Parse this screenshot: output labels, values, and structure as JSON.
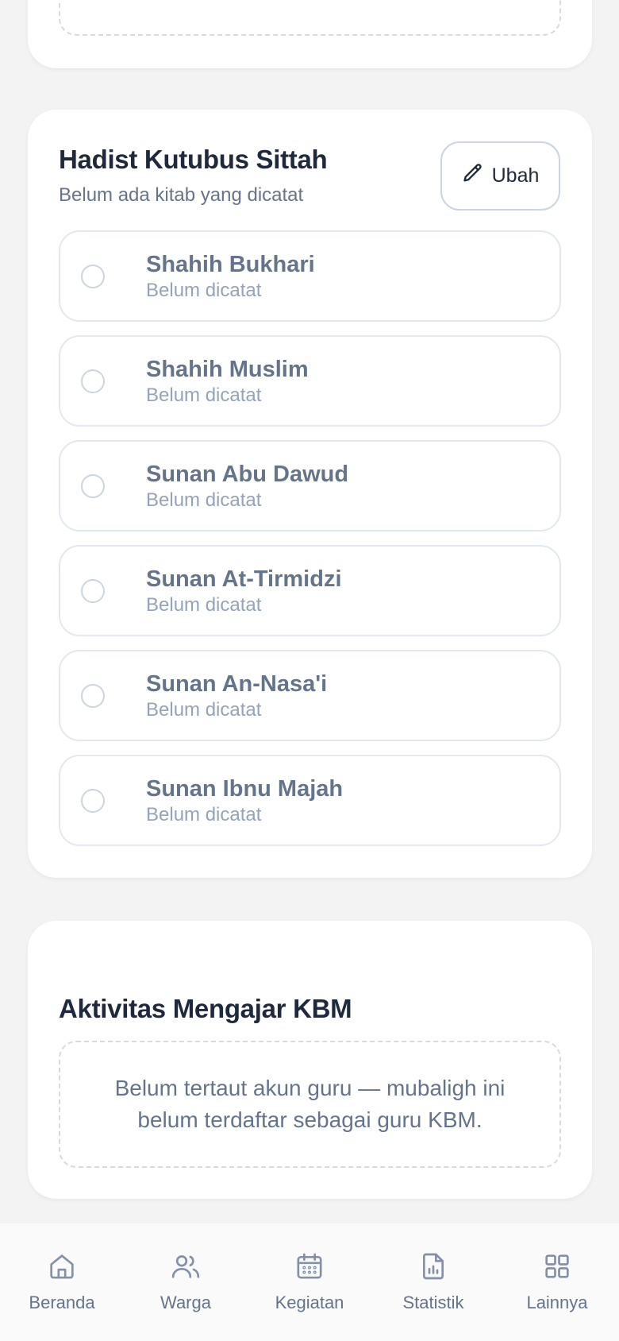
{
  "hadist": {
    "title": "Hadist Kutubus Sittah",
    "subtitle": "Belum ada kitab yang dicatat",
    "edit_label": "Ubah",
    "books": [
      {
        "name": "Shahih Bukhari",
        "status": "Belum dicatat"
      },
      {
        "name": "Shahih Muslim",
        "status": "Belum dicatat"
      },
      {
        "name": "Sunan Abu Dawud",
        "status": "Belum dicatat"
      },
      {
        "name": "Sunan At-Tirmidzi",
        "status": "Belum dicatat"
      },
      {
        "name": "Sunan An-Nasa'i",
        "status": "Belum dicatat"
      },
      {
        "name": "Sunan Ibnu Majah",
        "status": "Belum dicatat"
      }
    ]
  },
  "kbm": {
    "title": "Aktivitas Mengajar KBM",
    "empty_message": "Belum tertaut akun guru — mubaligh ini belum terdaftar sebagai guru KBM."
  },
  "nav": {
    "items": [
      {
        "label": "Beranda",
        "icon": "home-icon"
      },
      {
        "label": "Warga",
        "icon": "users-icon"
      },
      {
        "label": "Kegiatan",
        "icon": "calendar-icon"
      },
      {
        "label": "Statistik",
        "icon": "report-icon"
      },
      {
        "label": "Lainnya",
        "icon": "grid-icon"
      }
    ]
  },
  "colors": {
    "background": "#f3f3f4",
    "card": "#ffffff",
    "title": "#1e293b",
    "muted": "#64748b",
    "border": "#e2e8f0"
  }
}
